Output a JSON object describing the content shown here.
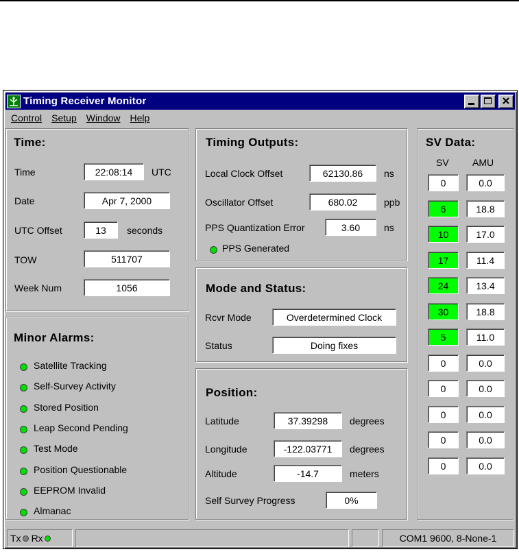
{
  "window": {
    "title": "Timing Receiver Monitor"
  },
  "menu": [
    "Control",
    "Setup",
    "Window",
    "Help"
  ],
  "time": {
    "title": "Time:",
    "time_label": "Time",
    "time_value": "22:08:14",
    "time_unit": "UTC",
    "date_label": "Date",
    "date_value": "Apr 7, 2000",
    "utc_offset_label": "UTC Offset",
    "utc_offset_value": "13",
    "utc_offset_unit": "seconds",
    "tow_label": "TOW",
    "tow_value": "511707",
    "week_label": "Week Num",
    "week_value": "1056"
  },
  "alarms": {
    "title": "Minor Alarms:",
    "items": [
      "Satellite Tracking",
      "Self-Survey Activity",
      "Stored Position",
      "Leap Second Pending",
      "Test Mode",
      "Position Questionable",
      "EEPROM Invalid",
      "Almanac"
    ]
  },
  "timing": {
    "title": "Timing Outputs:",
    "clock_label": "Local Clock Offset",
    "clock_value": "62130.86",
    "clock_unit": "ns",
    "osc_label": "Oscillator Offset",
    "osc_value": "680.02",
    "osc_unit": "ppb",
    "pps_label": "PPS Quantization Error",
    "pps_value": "3.60",
    "pps_unit": "ns",
    "pps_gen_label": "PPS Generated"
  },
  "mode": {
    "title": "Mode and Status:",
    "rcvr_label": "Rcvr Mode",
    "rcvr_value": "Overdetermined Clock",
    "status_label": "Status",
    "status_value": "Doing fixes"
  },
  "position": {
    "title": "Position:",
    "lat_label": "Latitude",
    "lat_value": "37.39298",
    "lat_unit": "degrees",
    "lon_label": "Longitude",
    "lon_value": "-122.03771",
    "lon_unit": "degrees",
    "alt_label": "Altitude",
    "alt_value": "-14.7",
    "alt_unit": "meters",
    "survey_label": "Self Survey Progress",
    "survey_value": "0%"
  },
  "sv": {
    "title": "SV Data:",
    "col_sv": "SV",
    "col_amu": "AMU",
    "rows": [
      {
        "sv": "0",
        "amu": "0.0"
      },
      {
        "sv": "6",
        "amu": "18.8"
      },
      {
        "sv": "10",
        "amu": "17.0"
      },
      {
        "sv": "17",
        "amu": "11.4"
      },
      {
        "sv": "24",
        "amu": "13.4"
      },
      {
        "sv": "30",
        "amu": "18.8"
      },
      {
        "sv": "5",
        "amu": "11.0"
      },
      {
        "sv": "0",
        "amu": "0.0"
      },
      {
        "sv": "0",
        "amu": "0.0"
      },
      {
        "sv": "0",
        "amu": "0.0"
      },
      {
        "sv": "0",
        "amu": "0.0"
      },
      {
        "sv": "0",
        "amu": "0.0"
      }
    ],
    "active_color": "#00ff00"
  },
  "status_bar": {
    "tx": "Tx",
    "rx": "Rx",
    "port": "COM1 9600, 8-None-1",
    "tx_led_color": "#808080",
    "rx_led_color": "#00e000"
  },
  "colors": {
    "window_bg": "#c0c0c0",
    "titlebar": "#000080",
    "led_on": "#00e000"
  }
}
